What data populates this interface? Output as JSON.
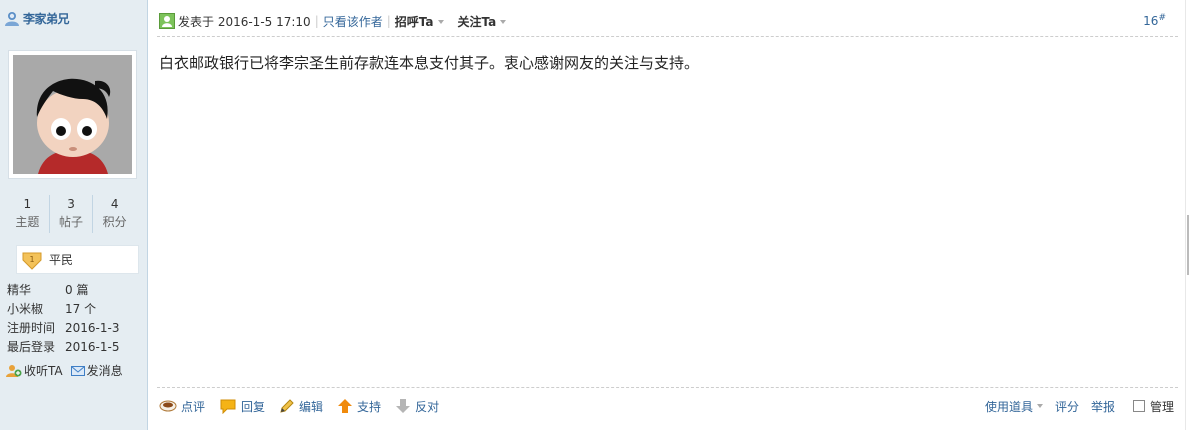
{
  "author": {
    "name": "李家弟兄"
  },
  "stats": [
    {
      "num": "1",
      "label": "主题"
    },
    {
      "num": "3",
      "label": "帖子"
    },
    {
      "num": "4",
      "label": "积分"
    }
  ],
  "rank": {
    "level": "1",
    "label": "平民"
  },
  "info": [
    {
      "k": "精华",
      "v": "0 篇"
    },
    {
      "k": "小米椒",
      "v": "17 个"
    },
    {
      "k": "注册时间",
      "v": "2016-1-3"
    },
    {
      "k": "最后登录",
      "v": "2016-1-5"
    }
  ],
  "sidebar_actions": {
    "follow": "收听TA",
    "message": "发消息"
  },
  "post": {
    "posted_at": "发表于 2016-1-5 17:10",
    "only_author": "只看该作者",
    "greet": "招呼Ta",
    "follow": "关注Ta",
    "floor": "16",
    "floor_mark": "#",
    "content": "白衣邮政银行已将李宗圣生前存款连本息支付其子。衷心感谢网友的关注与支持。"
  },
  "footer": {
    "comment": "点评",
    "reply": "回复",
    "edit": "编辑",
    "support": "支持",
    "oppose": "反对",
    "tools": "使用道具",
    "rate": "评分",
    "report": "举报",
    "manage": "管理"
  },
  "colors": {
    "link": "#336699",
    "sidebar_bg": "#e5edf2",
    "border": "#c2d5e3"
  }
}
